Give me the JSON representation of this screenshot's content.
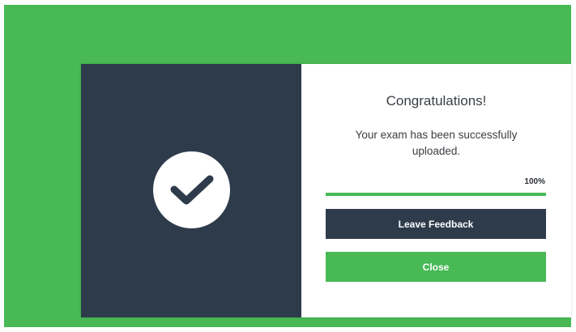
{
  "dialog": {
    "title": "Congratulations!",
    "message": "Your exam has been successfully uploaded.",
    "progress": {
      "percent": 100,
      "label": "100%"
    },
    "buttons": {
      "feedback_label": "Leave Feedback",
      "close_label": "Close"
    },
    "icon": "checkmark-icon"
  },
  "colors": {
    "background_green": "#48b955",
    "panel_dark": "#2e3b4b",
    "button_green": "#48b955",
    "button_dark": "#2e3b4b"
  }
}
